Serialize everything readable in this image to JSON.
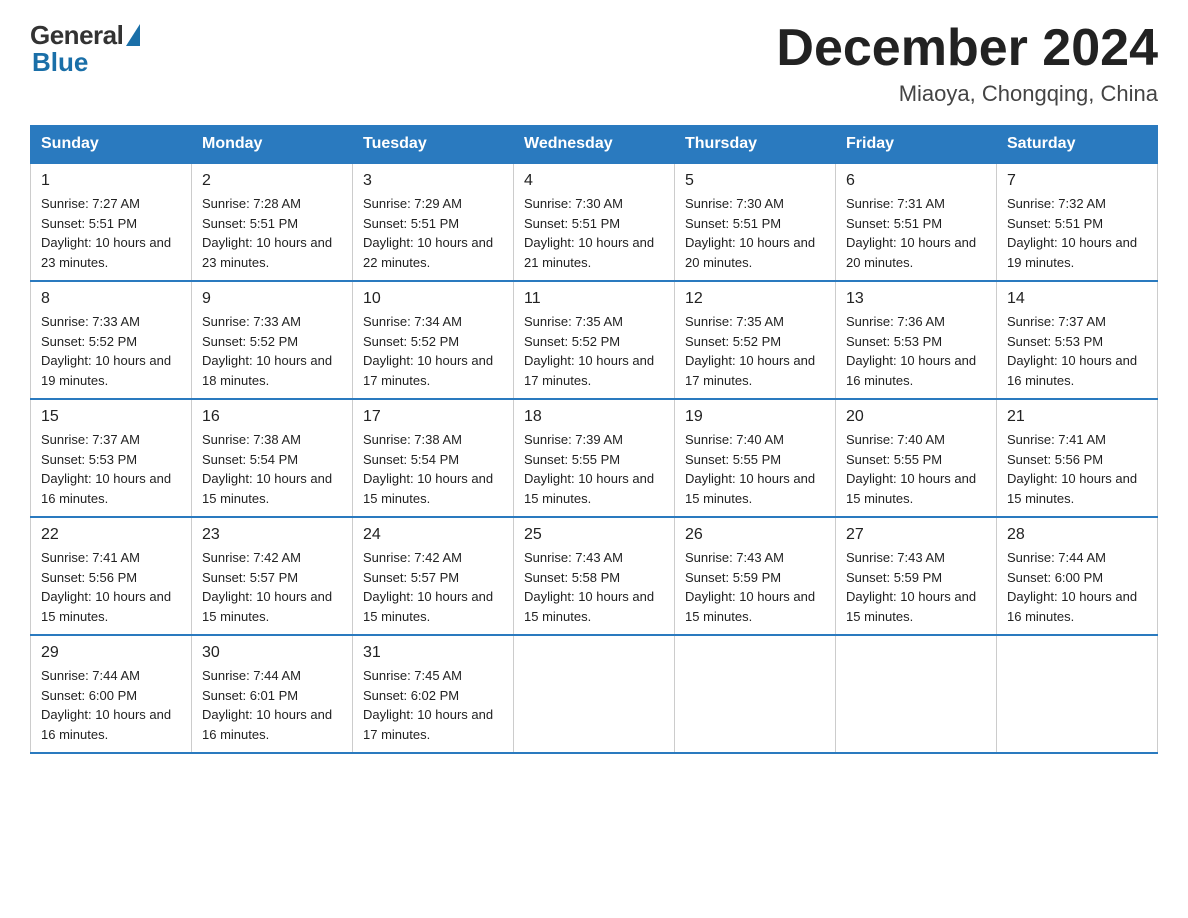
{
  "logo": {
    "general": "General",
    "blue": "Blue"
  },
  "header": {
    "month": "December 2024",
    "location": "Miaoya, Chongqing, China"
  },
  "days_of_week": [
    "Sunday",
    "Monday",
    "Tuesday",
    "Wednesday",
    "Thursday",
    "Friday",
    "Saturday"
  ],
  "weeks": [
    [
      {
        "day": "1",
        "sunrise": "7:27 AM",
        "sunset": "5:51 PM",
        "daylight": "10 hours and 23 minutes."
      },
      {
        "day": "2",
        "sunrise": "7:28 AM",
        "sunset": "5:51 PM",
        "daylight": "10 hours and 23 minutes."
      },
      {
        "day": "3",
        "sunrise": "7:29 AM",
        "sunset": "5:51 PM",
        "daylight": "10 hours and 22 minutes."
      },
      {
        "day": "4",
        "sunrise": "7:30 AM",
        "sunset": "5:51 PM",
        "daylight": "10 hours and 21 minutes."
      },
      {
        "day": "5",
        "sunrise": "7:30 AM",
        "sunset": "5:51 PM",
        "daylight": "10 hours and 20 minutes."
      },
      {
        "day": "6",
        "sunrise": "7:31 AM",
        "sunset": "5:51 PM",
        "daylight": "10 hours and 20 minutes."
      },
      {
        "day": "7",
        "sunrise": "7:32 AM",
        "sunset": "5:51 PM",
        "daylight": "10 hours and 19 minutes."
      }
    ],
    [
      {
        "day": "8",
        "sunrise": "7:33 AM",
        "sunset": "5:52 PM",
        "daylight": "10 hours and 19 minutes."
      },
      {
        "day": "9",
        "sunrise": "7:33 AM",
        "sunset": "5:52 PM",
        "daylight": "10 hours and 18 minutes."
      },
      {
        "day": "10",
        "sunrise": "7:34 AM",
        "sunset": "5:52 PM",
        "daylight": "10 hours and 17 minutes."
      },
      {
        "day": "11",
        "sunrise": "7:35 AM",
        "sunset": "5:52 PM",
        "daylight": "10 hours and 17 minutes."
      },
      {
        "day": "12",
        "sunrise": "7:35 AM",
        "sunset": "5:52 PM",
        "daylight": "10 hours and 17 minutes."
      },
      {
        "day": "13",
        "sunrise": "7:36 AM",
        "sunset": "5:53 PM",
        "daylight": "10 hours and 16 minutes."
      },
      {
        "day": "14",
        "sunrise": "7:37 AM",
        "sunset": "5:53 PM",
        "daylight": "10 hours and 16 minutes."
      }
    ],
    [
      {
        "day": "15",
        "sunrise": "7:37 AM",
        "sunset": "5:53 PM",
        "daylight": "10 hours and 16 minutes."
      },
      {
        "day": "16",
        "sunrise": "7:38 AM",
        "sunset": "5:54 PM",
        "daylight": "10 hours and 15 minutes."
      },
      {
        "day": "17",
        "sunrise": "7:38 AM",
        "sunset": "5:54 PM",
        "daylight": "10 hours and 15 minutes."
      },
      {
        "day": "18",
        "sunrise": "7:39 AM",
        "sunset": "5:55 PM",
        "daylight": "10 hours and 15 minutes."
      },
      {
        "day": "19",
        "sunrise": "7:40 AM",
        "sunset": "5:55 PM",
        "daylight": "10 hours and 15 minutes."
      },
      {
        "day": "20",
        "sunrise": "7:40 AM",
        "sunset": "5:55 PM",
        "daylight": "10 hours and 15 minutes."
      },
      {
        "day": "21",
        "sunrise": "7:41 AM",
        "sunset": "5:56 PM",
        "daylight": "10 hours and 15 minutes."
      }
    ],
    [
      {
        "day": "22",
        "sunrise": "7:41 AM",
        "sunset": "5:56 PM",
        "daylight": "10 hours and 15 minutes."
      },
      {
        "day": "23",
        "sunrise": "7:42 AM",
        "sunset": "5:57 PM",
        "daylight": "10 hours and 15 minutes."
      },
      {
        "day": "24",
        "sunrise": "7:42 AM",
        "sunset": "5:57 PM",
        "daylight": "10 hours and 15 minutes."
      },
      {
        "day": "25",
        "sunrise": "7:43 AM",
        "sunset": "5:58 PM",
        "daylight": "10 hours and 15 minutes."
      },
      {
        "day": "26",
        "sunrise": "7:43 AM",
        "sunset": "5:59 PM",
        "daylight": "10 hours and 15 minutes."
      },
      {
        "day": "27",
        "sunrise": "7:43 AM",
        "sunset": "5:59 PM",
        "daylight": "10 hours and 15 minutes."
      },
      {
        "day": "28",
        "sunrise": "7:44 AM",
        "sunset": "6:00 PM",
        "daylight": "10 hours and 16 minutes."
      }
    ],
    [
      {
        "day": "29",
        "sunrise": "7:44 AM",
        "sunset": "6:00 PM",
        "daylight": "10 hours and 16 minutes."
      },
      {
        "day": "30",
        "sunrise": "7:44 AM",
        "sunset": "6:01 PM",
        "daylight": "10 hours and 16 minutes."
      },
      {
        "day": "31",
        "sunrise": "7:45 AM",
        "sunset": "6:02 PM",
        "daylight": "10 hours and 17 minutes."
      },
      null,
      null,
      null,
      null
    ]
  ]
}
